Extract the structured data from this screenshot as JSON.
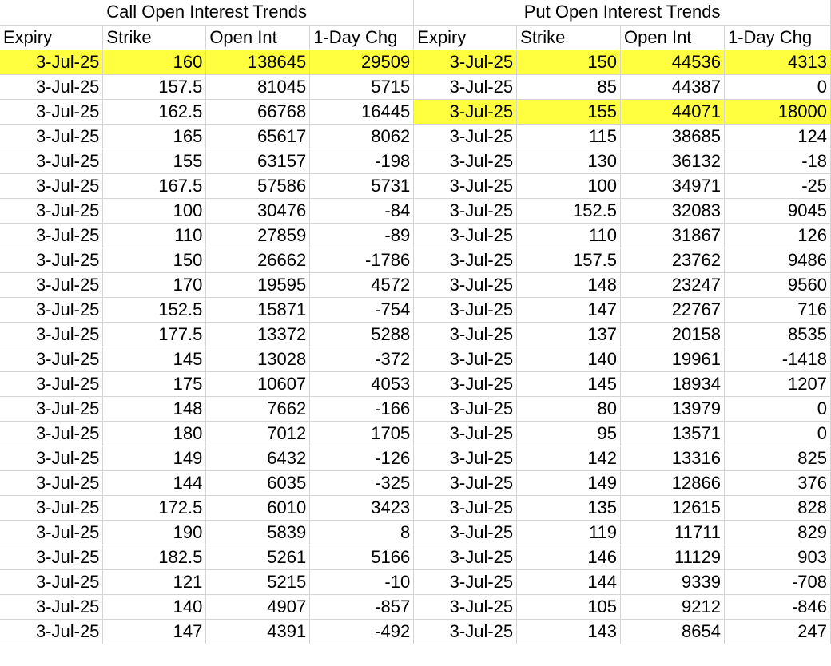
{
  "call": {
    "title": "Call Open Interest Trends",
    "headers": [
      "Expiry",
      "Strike",
      "Open Int",
      "1-Day Chg"
    ],
    "rows": [
      [
        "3-Jul-25",
        "160",
        "138645",
        "29509"
      ],
      [
        "3-Jul-25",
        "157.5",
        "81045",
        "5715"
      ],
      [
        "3-Jul-25",
        "162.5",
        "66768",
        "16445"
      ],
      [
        "3-Jul-25",
        "165",
        "65617",
        "8062"
      ],
      [
        "3-Jul-25",
        "155",
        "63157",
        "-198"
      ],
      [
        "3-Jul-25",
        "167.5",
        "57586",
        "5731"
      ],
      [
        "3-Jul-25",
        "100",
        "30476",
        "-84"
      ],
      [
        "3-Jul-25",
        "110",
        "27859",
        "-89"
      ],
      [
        "3-Jul-25",
        "150",
        "26662",
        "-1786"
      ],
      [
        "3-Jul-25",
        "170",
        "19595",
        "4572"
      ],
      [
        "3-Jul-25",
        "152.5",
        "15871",
        "-754"
      ],
      [
        "3-Jul-25",
        "177.5",
        "13372",
        "5288"
      ],
      [
        "3-Jul-25",
        "145",
        "13028",
        "-372"
      ],
      [
        "3-Jul-25",
        "175",
        "10607",
        "4053"
      ],
      [
        "3-Jul-25",
        "148",
        "7662",
        "-166"
      ],
      [
        "3-Jul-25",
        "180",
        "7012",
        "1705"
      ],
      [
        "3-Jul-25",
        "149",
        "6432",
        "-126"
      ],
      [
        "3-Jul-25",
        "144",
        "6035",
        "-325"
      ],
      [
        "3-Jul-25",
        "172.5",
        "6010",
        "3423"
      ],
      [
        "3-Jul-25",
        "190",
        "5839",
        "8"
      ],
      [
        "3-Jul-25",
        "182.5",
        "5261",
        "5166"
      ],
      [
        "3-Jul-25",
        "121",
        "5215",
        "-10"
      ],
      [
        "3-Jul-25",
        "140",
        "4907",
        "-857"
      ],
      [
        "3-Jul-25",
        "147",
        "4391",
        "-492"
      ]
    ],
    "highlight_rows": [
      0
    ]
  },
  "put": {
    "title": "Put Open Interest Trends",
    "headers": [
      "Expiry",
      "Strike",
      "Open Int",
      "1-Day Chg"
    ],
    "rows": [
      [
        "3-Jul-25",
        "150",
        "44536",
        "4313"
      ],
      [
        "3-Jul-25",
        "85",
        "44387",
        "0"
      ],
      [
        "3-Jul-25",
        "155",
        "44071",
        "18000"
      ],
      [
        "3-Jul-25",
        "115",
        "38685",
        "124"
      ],
      [
        "3-Jul-25",
        "130",
        "36132",
        "-18"
      ],
      [
        "3-Jul-25",
        "100",
        "34971",
        "-25"
      ],
      [
        "3-Jul-25",
        "152.5",
        "32083",
        "9045"
      ],
      [
        "3-Jul-25",
        "110",
        "31867",
        "126"
      ],
      [
        "3-Jul-25",
        "157.5",
        "23762",
        "9486"
      ],
      [
        "3-Jul-25",
        "148",
        "23247",
        "9560"
      ],
      [
        "3-Jul-25",
        "147",
        "22767",
        "716"
      ],
      [
        "3-Jul-25",
        "137",
        "20158",
        "8535"
      ],
      [
        "3-Jul-25",
        "140",
        "19961",
        "-1418"
      ],
      [
        "3-Jul-25",
        "145",
        "18934",
        "1207"
      ],
      [
        "3-Jul-25",
        "80",
        "13979",
        "0"
      ],
      [
        "3-Jul-25",
        "95",
        "13571",
        "0"
      ],
      [
        "3-Jul-25",
        "142",
        "13316",
        "825"
      ],
      [
        "3-Jul-25",
        "149",
        "12866",
        "376"
      ],
      [
        "3-Jul-25",
        "135",
        "12615",
        "828"
      ],
      [
        "3-Jul-25",
        "119",
        "11711",
        "829"
      ],
      [
        "3-Jul-25",
        "146",
        "11129",
        "903"
      ],
      [
        "3-Jul-25",
        "144",
        "9339",
        "-708"
      ],
      [
        "3-Jul-25",
        "105",
        "9212",
        "-846"
      ],
      [
        "3-Jul-25",
        "143",
        "8654",
        "247"
      ]
    ],
    "highlight_rows": [
      0,
      2
    ]
  },
  "colors": {
    "highlight": "#ffff40",
    "gridline": "#d4d4d4"
  }
}
